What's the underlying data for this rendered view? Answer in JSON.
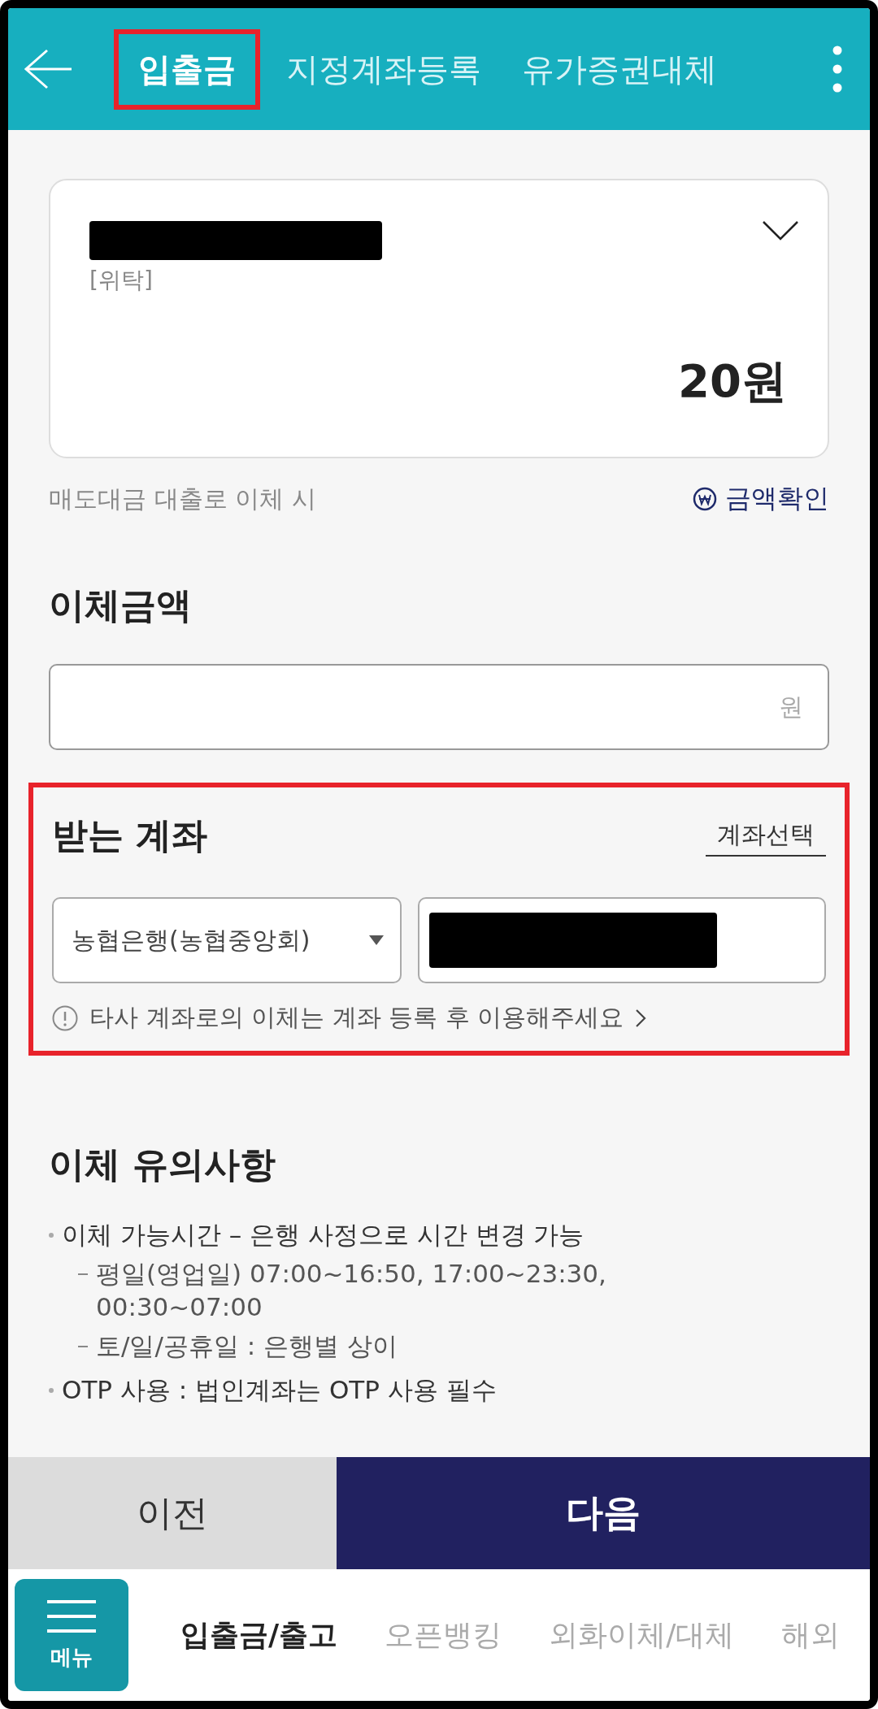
{
  "header": {
    "tabs": [
      {
        "label": "입출금",
        "selected": true,
        "highlighted": true
      },
      {
        "label": "지정계좌등록",
        "selected": false,
        "highlighted": false
      },
      {
        "label": "유가증권대체",
        "selected": false,
        "highlighted": false
      }
    ]
  },
  "account_card": {
    "account_type": "[위탁]",
    "balance": "20원"
  },
  "loan_note": "매도대금 대출로 이체 시",
  "amount_check_link": "금액확인",
  "transfer_amount": {
    "title": "이체금액",
    "unit": "원"
  },
  "recipient": {
    "highlighted": true,
    "title": "받는 계좌",
    "select_link": "계좌선택",
    "bank": "농협은행(농협중앙회)",
    "notice": "타사 계좌로의 이체는 계좌 등록 후 이용해주세요"
  },
  "precautions": {
    "title": "이체 유의사항",
    "items": [
      {
        "text": "이체 가능시간 – 은행 사정으로 시간 변경 가능",
        "children": [
          {
            "text": "평일(영업일) 07:00~16:50, 17:00~23:30, 00:30~07:00"
          },
          {
            "text": "토/일/공휴일 : 은행별 상이"
          }
        ]
      },
      {
        "text": "OTP 사용 : 법인계좌는 OTP 사용 필수"
      }
    ]
  },
  "buttons": {
    "previous": "이전",
    "next": "다음"
  },
  "bottom_nav": {
    "menu_label": "메뉴",
    "items": [
      {
        "label": "입출금/출고",
        "selected": true
      },
      {
        "label": "오픈뱅킹",
        "selected": false
      },
      {
        "label": "외화이체/대체",
        "selected": false
      },
      {
        "label": "해외",
        "selected": false
      }
    ]
  }
}
